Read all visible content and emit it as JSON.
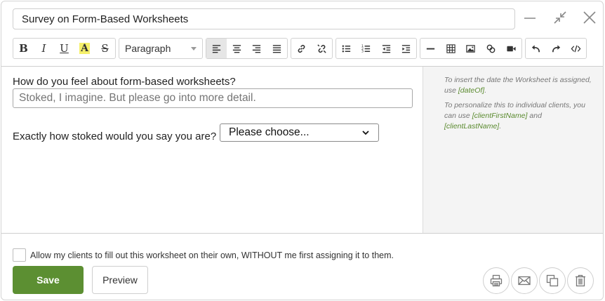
{
  "title": {
    "value": "Survey on Form-Based Worksheets"
  },
  "window": {
    "minimize_icon": "minimize-icon",
    "shrink_icon": "shrink-icon",
    "close_icon": "close-icon"
  },
  "toolbar": {
    "bold": "B",
    "italic": "I",
    "underline": "U",
    "highlight": "A",
    "strike": "S",
    "format_select": "Paragraph",
    "icons": [
      "bold-icon",
      "italic-icon",
      "underline-icon",
      "highlight-icon",
      "strikethrough-icon",
      "align-left-icon",
      "align-center-icon",
      "align-right-icon",
      "align-justify-icon",
      "link-icon",
      "unlink-icon",
      "bullet-list-icon",
      "numbered-list-icon",
      "outdent-icon",
      "indent-icon",
      "horizontal-rule-icon",
      "table-icon",
      "image-icon",
      "embed-icon",
      "video-icon",
      "undo-icon",
      "redo-icon",
      "source-code-icon"
    ]
  },
  "editor": {
    "question1": "How do you feel about form-based worksheets?",
    "answer1_placeholder": "Stoked, I imagine. But please go into more detail.",
    "question2": "Exactly how stoked would you say you are?",
    "select_value": "Please choose..."
  },
  "sidebar": {
    "date_text": "To insert the date the Worksheet is assigned, use ",
    "date_token": "[dateOf]",
    "date_end": ".",
    "personalize_text": "To personalize this to individual clients, you can use ",
    "first_token": "[clientFirstName]",
    "and_text": " and ",
    "last_token": "[clientLastName]",
    "personalize_end": "."
  },
  "footer": {
    "checkbox_label": "Allow my clients to fill out this worksheet on their own, WITHOUT me first assigning it to them.",
    "checkbox_checked": false,
    "save_label": "Save",
    "preview_label": "Preview",
    "action_icons": [
      "print-icon",
      "email-icon",
      "duplicate-icon",
      "trash-icon"
    ]
  },
  "colors": {
    "accent": "#5c8f32",
    "token": "#5a8a2e",
    "sidebar_bg": "#f4f4f4"
  }
}
